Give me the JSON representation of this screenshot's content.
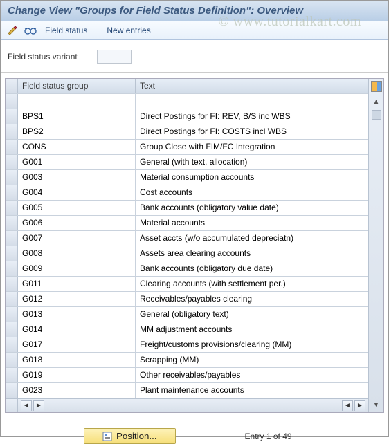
{
  "title": "Change View \"Groups for Field Status Definition\": Overview",
  "toolbar": {
    "field_status_label": "Field status",
    "new_entries_label": "New entries"
  },
  "watermark": "© www.tutorialkart.com",
  "filter": {
    "label": "Field status variant",
    "value": ""
  },
  "grid": {
    "columns": {
      "fsg": "Field status group",
      "text": "Text"
    },
    "rows": [
      {
        "fsg": "",
        "text": ""
      },
      {
        "fsg": "BPS1",
        "text": "Direct Postings for FI: REV, B/S inc WBS"
      },
      {
        "fsg": "BPS2",
        "text": "Direct Postings for FI: COSTS incl WBS"
      },
      {
        "fsg": "CONS",
        "text": "Group Close with FIM/FC Integration"
      },
      {
        "fsg": "G001",
        "text": "General (with text, allocation)"
      },
      {
        "fsg": "G003",
        "text": "Material consumption accounts"
      },
      {
        "fsg": "G004",
        "text": "Cost accounts"
      },
      {
        "fsg": "G005",
        "text": "Bank accounts (obligatory value date)"
      },
      {
        "fsg": "G006",
        "text": "Material accounts"
      },
      {
        "fsg": "G007",
        "text": "Asset accts (w/o accumulated depreciatn)"
      },
      {
        "fsg": "G008",
        "text": "Assets area clearing accounts"
      },
      {
        "fsg": "G009",
        "text": "Bank accounts (obligatory due date)"
      },
      {
        "fsg": "G011",
        "text": "Clearing accounts (with settlement per.)"
      },
      {
        "fsg": "G012",
        "text": "Receivables/payables clearing"
      },
      {
        "fsg": "G013",
        "text": "General (obligatory text)"
      },
      {
        "fsg": "G014",
        "text": "MM adjustment accounts"
      },
      {
        "fsg": "G017",
        "text": "Freight/customs provisions/clearing (MM)"
      },
      {
        "fsg": "G018",
        "text": "Scrapping (MM)"
      },
      {
        "fsg": "G019",
        "text": "Other receivables/payables"
      },
      {
        "fsg": "G023",
        "text": "Plant maintenance accounts"
      }
    ]
  },
  "footer": {
    "position_label": "Position...",
    "entry_text": "Entry 1 of 49"
  }
}
